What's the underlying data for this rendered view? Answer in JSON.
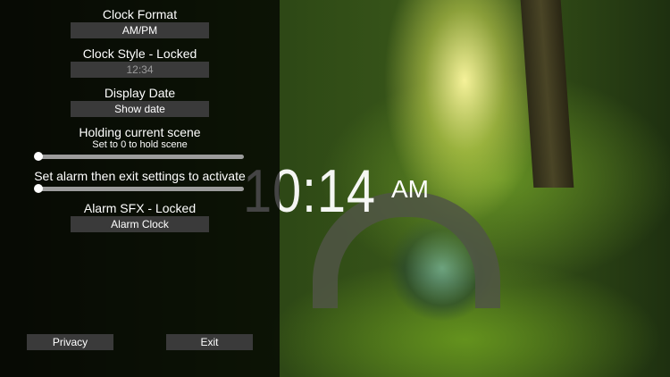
{
  "settings": {
    "clock_format": {
      "label": "Clock Format",
      "value": "AM/PM"
    },
    "clock_style": {
      "label": "Clock Style - Locked",
      "value": "12:34"
    },
    "display_date": {
      "label": "Display Date",
      "value": "Show date"
    },
    "hold_scene": {
      "label": "Holding current scene",
      "sublabel": "Set to 0 to hold scene",
      "value": 0
    },
    "alarm": {
      "label": "Set alarm then exit settings to activate",
      "value": 0
    },
    "alarm_sfx": {
      "label": "Alarm SFX - Locked",
      "value": "Alarm Clock"
    }
  },
  "buttons": {
    "privacy": "Privacy",
    "exit": "Exit"
  },
  "clock": {
    "time": "10:14",
    "ampm": "AM"
  }
}
